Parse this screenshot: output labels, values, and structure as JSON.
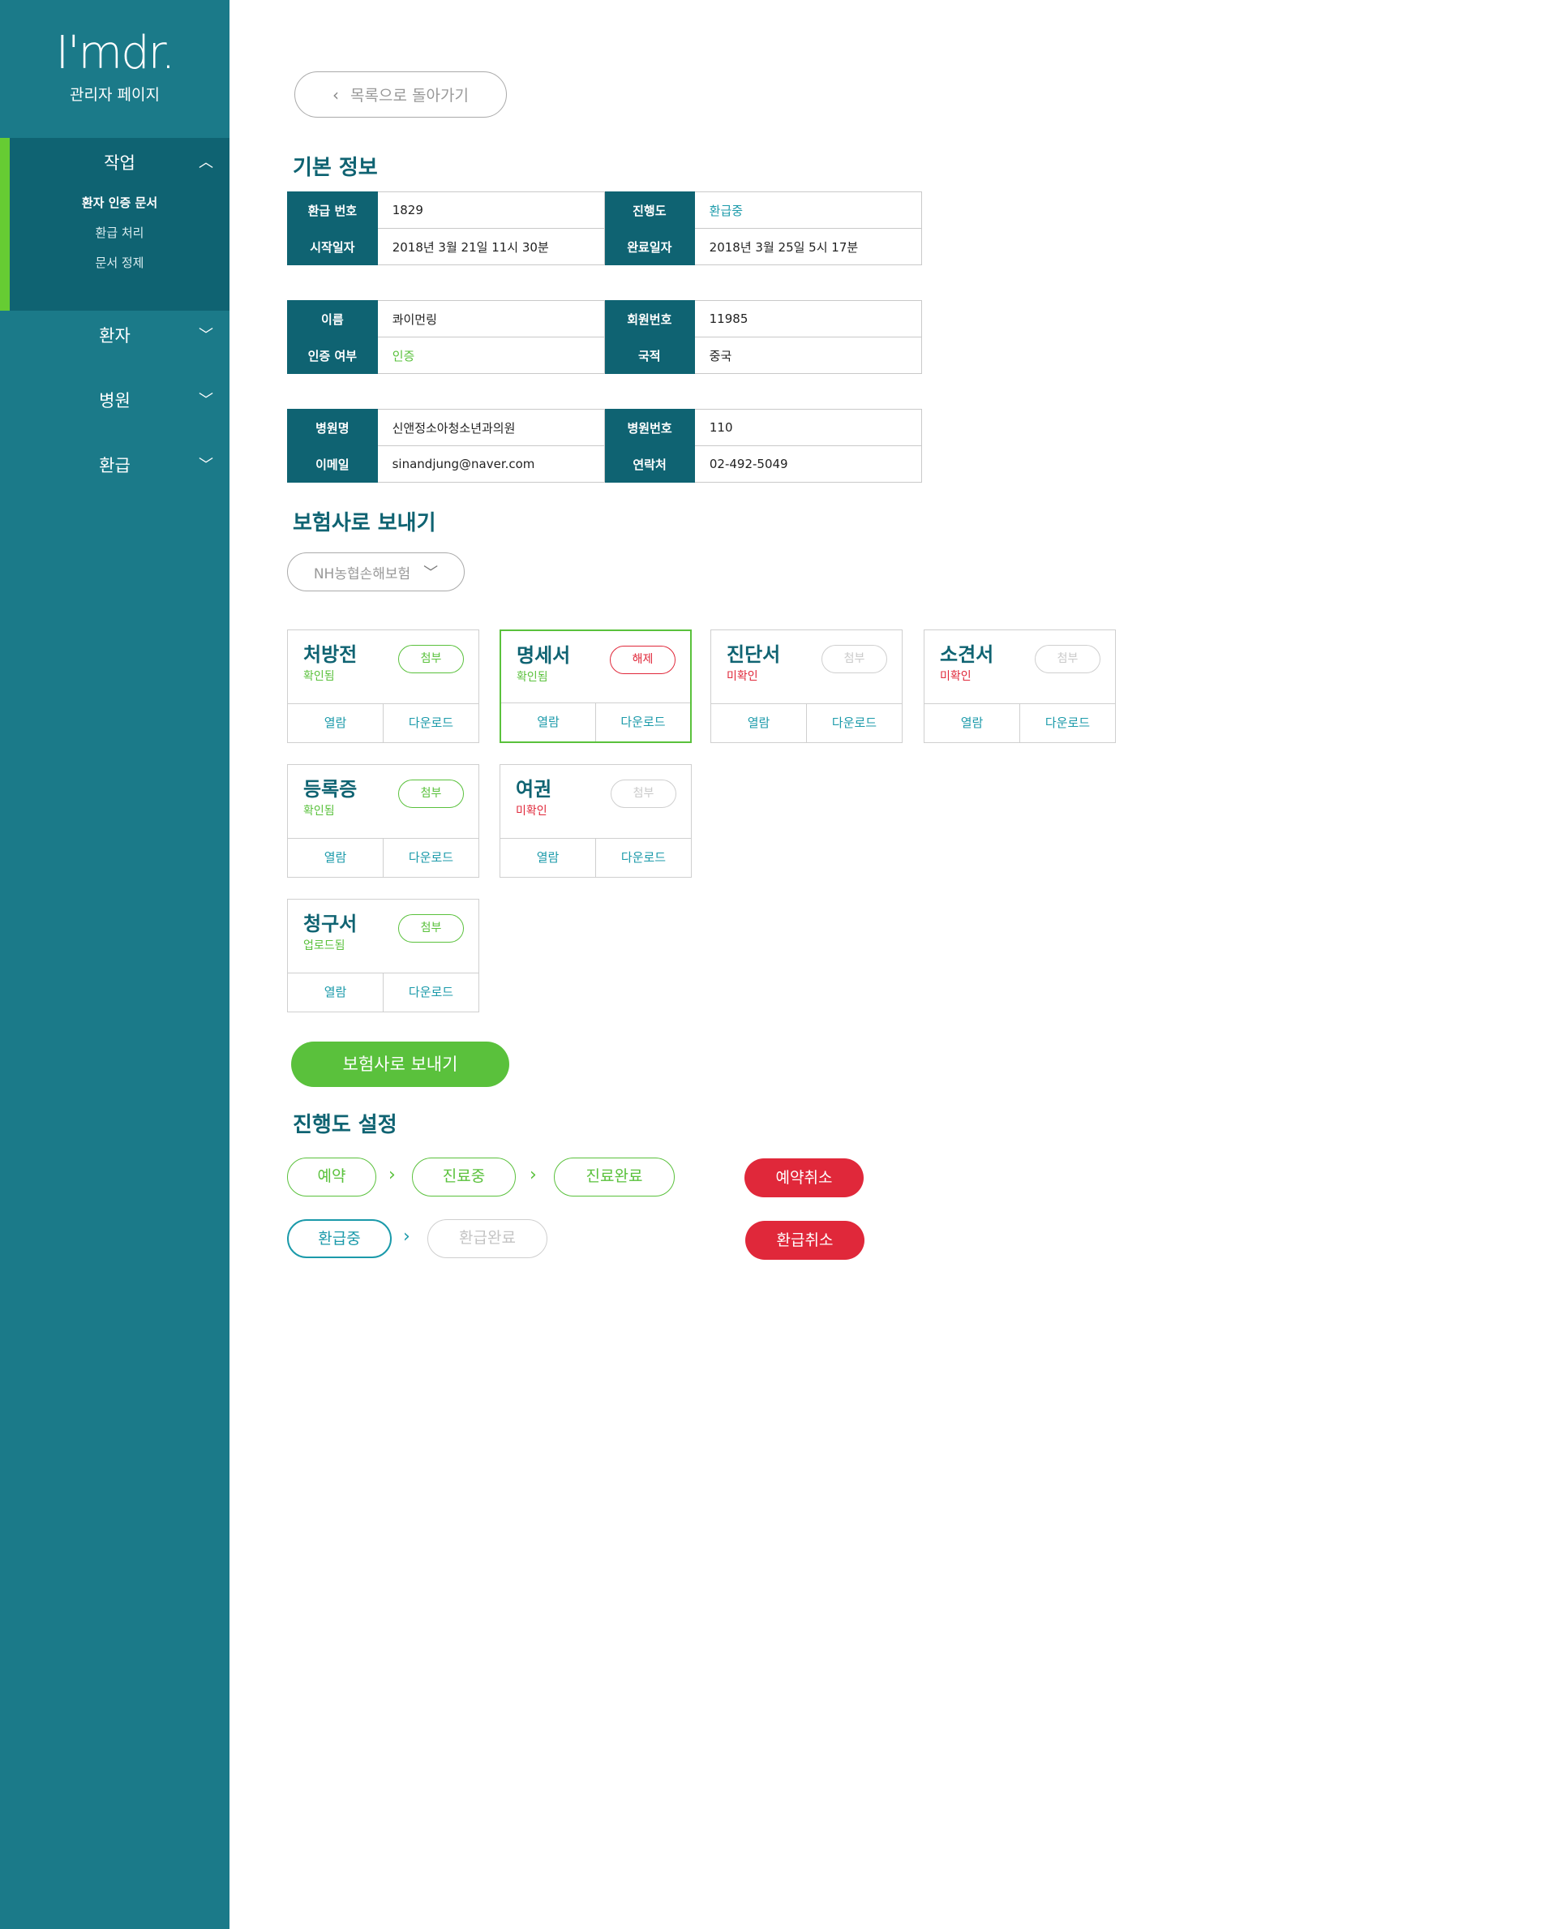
{
  "sidebar": {
    "logo": "I'mdr.",
    "subtitle": "관리자 페이지",
    "menu": [
      {
        "label": "작업",
        "expanded": true,
        "items": [
          {
            "label": "환자 인증 문서",
            "active": true
          },
          {
            "label": "환급 처리",
            "active": false
          },
          {
            "label": "문서 정제",
            "active": false
          }
        ]
      },
      {
        "label": "환자",
        "expanded": false
      },
      {
        "label": "병원",
        "expanded": false
      },
      {
        "label": "환급",
        "expanded": false
      }
    ]
  },
  "back_button": "목록으로 돌아가기",
  "basic_info": {
    "title": "기본 정보",
    "refund": {
      "refund_no_label": "환급 번호",
      "refund_no": "1829",
      "progress_label": "진행도",
      "progress": "환급중",
      "start_label": "시작일자",
      "start": "2018년 3월 21일 11시 30분",
      "end_label": "완료일자",
      "end": "2018년 3월 25일 5시 17분"
    },
    "patient": {
      "name_label": "이름",
      "name": "콰이먼링",
      "member_label": "회원번호",
      "member": "11985",
      "auth_label": "인증 여부",
      "auth": "인증",
      "nation_label": "국적",
      "nation": "중국"
    },
    "hospital": {
      "name_label": "병원명",
      "name": "신앤정소아청소년과의원",
      "no_label": "병원번호",
      "no": "110",
      "email_label": "이메일",
      "email": "sinandjung@naver.com",
      "phone_label": "연락처",
      "phone": "02-492-5049"
    }
  },
  "insurance": {
    "title": "보험사로 보내기",
    "selected_company": "NH농협손해보험",
    "documents": [
      {
        "title": "처방전",
        "status": "확인됨",
        "ok": true,
        "button": "첨부",
        "style": "green",
        "view": "열람",
        "download": "다운로드"
      },
      {
        "title": "명세서",
        "status": "확인됨",
        "ok": true,
        "button": "해제",
        "style": "red",
        "view": "열람",
        "download": "다운로드"
      },
      {
        "title": "진단서",
        "status": "미확인",
        "ok": false,
        "button": "첨부",
        "style": "grey",
        "view": "열람",
        "download": "다운로드"
      },
      {
        "title": "소견서",
        "status": "미확인",
        "ok": false,
        "button": "첨부",
        "style": "grey",
        "view": "열람",
        "download": "다운로드"
      },
      {
        "title": "등록증",
        "status": "확인됨",
        "ok": true,
        "button": "첨부",
        "style": "green",
        "view": "열람",
        "download": "다운로드"
      },
      {
        "title": "여권",
        "status": "미확인",
        "ok": false,
        "button": "첨부",
        "style": "grey",
        "view": "열람",
        "download": "다운로드"
      },
      {
        "title": "청구서",
        "status": "업로드됨",
        "ok": true,
        "button": "첨부",
        "style": "green",
        "view": "열람",
        "download": "다운로드"
      }
    ],
    "send_button": "보험사로 보내기"
  },
  "progress_setting": {
    "title": "진행도 설정",
    "steps_row1": [
      "예약",
      "진료중",
      "진료완료"
    ],
    "cancel1": "예약취소",
    "steps_row2": [
      "환급중",
      "환급완료"
    ],
    "cancel2": "환급취소"
  },
  "colors": {
    "sidebar": "#1b7a89",
    "sidebar_active": "#0f6372",
    "accent_green": "#5ac13c",
    "accent_teal": "#1b9aaa",
    "danger": "#e0283a"
  }
}
